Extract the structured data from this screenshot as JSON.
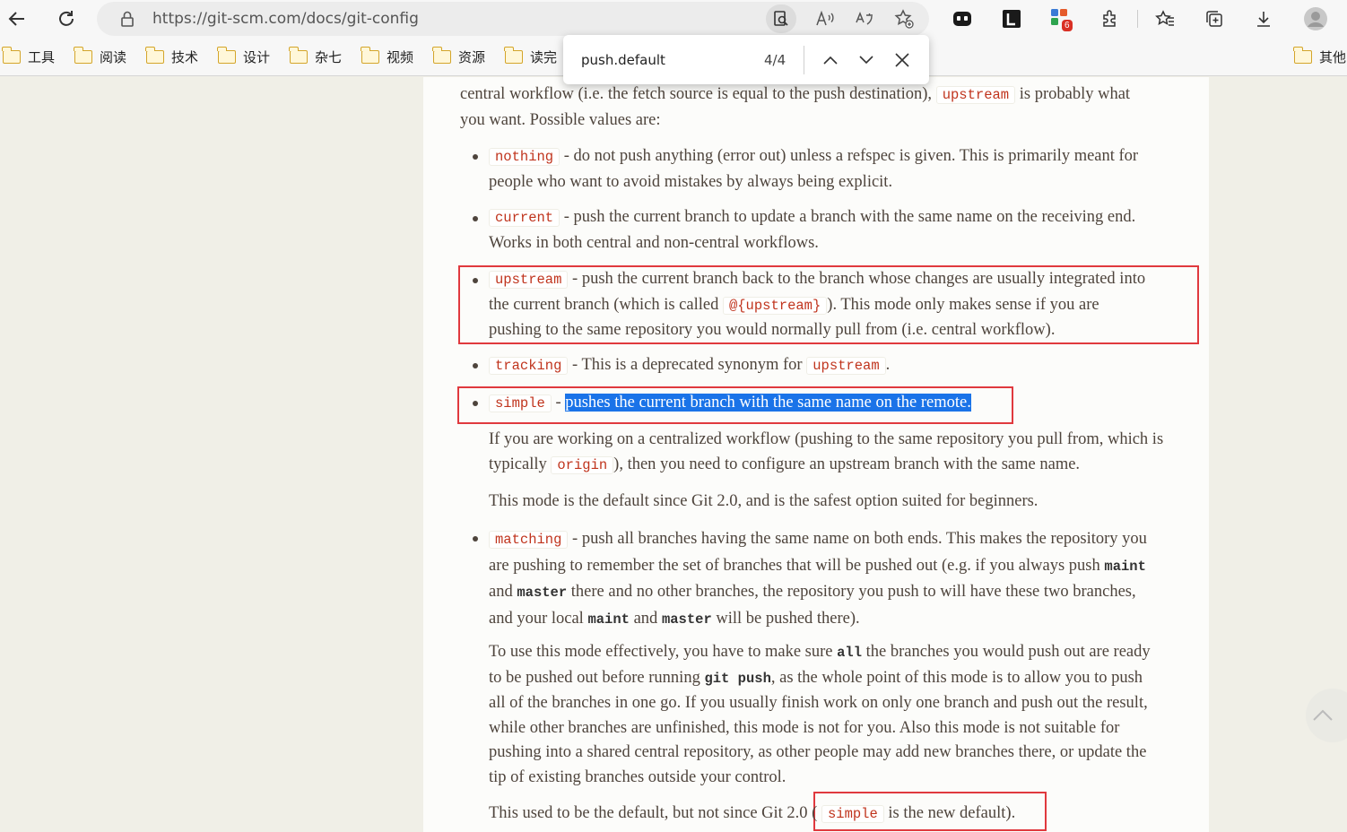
{
  "browser": {
    "url": "https://git-scm.com/docs/git-config",
    "extension_badge": "6",
    "bookmarks": [
      "工具",
      "阅读",
      "技术",
      "设计",
      "杂七",
      "视频",
      "资源",
      "读完"
    ],
    "bookmarks_right": "其他"
  },
  "findbar": {
    "query": "push.default",
    "count": "4/4"
  },
  "doc": {
    "intro_line1_a": "central workflow (i.e. the fetch source is equal to the push destination),",
    "intro_code": "upstream",
    "intro_line1_b": "is probably what",
    "intro_line2": "you want. Possible values are:",
    "nothing_code": "nothing",
    "nothing_l1": "- do not push anything (error out) unless a refspec is given. This is primarily meant for",
    "nothing_l2": "people who want to avoid mistakes by always being explicit.",
    "current_code": "current",
    "current_l1": "- push the current branch to update a branch with the same name on the receiving end.",
    "current_l2": "Works in both central and non-central workflows.",
    "upstream_code": "upstream",
    "upstream_l1": "- push the current branch back to the branch whose changes are usually integrated into",
    "upstream_l2a": "the current branch (which is called",
    "upstream_l2_code": "@{upstream}",
    "upstream_l2b": "). This mode only makes sense if you are",
    "upstream_l3": "pushing to the same repository you would normally pull from (i.e. central workflow).",
    "tracking_code": "tracking",
    "tracking_text": "- This is a deprecated synonym for",
    "tracking_code2": "upstream",
    "tracking_end": ".",
    "simple_code": "simple",
    "simple_dash": "-",
    "simple_hl": "pushes the current branch with the same name on the remote.",
    "simple_p1_l1": "If you are working on a centralized workflow (pushing to the same repository you pull from, which is",
    "simple_p1_l2a": "typically",
    "simple_p1_code": "origin",
    "simple_p1_l2b": "), then you need to configure an upstream branch with the same name.",
    "simple_p2": "This mode is the default since Git 2.0, and is the safest option suited for beginners.",
    "matching_code": "matching",
    "matching_l1": "- push all branches having the same name on both ends. This makes the repository you",
    "matching_l2a": "are pushing to remember the set of branches that will be pushed out (e.g. if you always push",
    "matching_maint": "maint",
    "matching_l3a": "and",
    "matching_master": "master",
    "matching_l3b": "there and no other branches, the repository you push to will have these two branches,",
    "matching_l4a": "and your local",
    "matching_maint2": "maint",
    "matching_l4b": "and",
    "matching_master2": "master",
    "matching_l4c": "will be pushed there).",
    "eff_l1a": "To use this mode effectively, you have to make sure",
    "eff_all": "all",
    "eff_l1b": "the branches you would push out are ready",
    "eff_l2a": "to be pushed out before running",
    "eff_git_push": "git push",
    "eff_l2b": ", as the whole point of this mode is to allow you to push",
    "eff_l3": "all of the branches in one go. If you usually finish work on only one branch and push out the result,",
    "eff_l4": "while other branches are unfinished, this mode is not for you. Also this mode is not suitable for",
    "eff_l5": "pushing into a shared central repository, as other people may add new branches there, or update the",
    "eff_l6": "tip of existing branches outside your control.",
    "last_a": "This used to be the default, but not since Git 2.0 (",
    "last_code": "simple",
    "last_b": "is the new default)."
  },
  "colors": {
    "code": "#c0341d",
    "highlight": "#1a73e8",
    "annotation": "#e0393e"
  }
}
